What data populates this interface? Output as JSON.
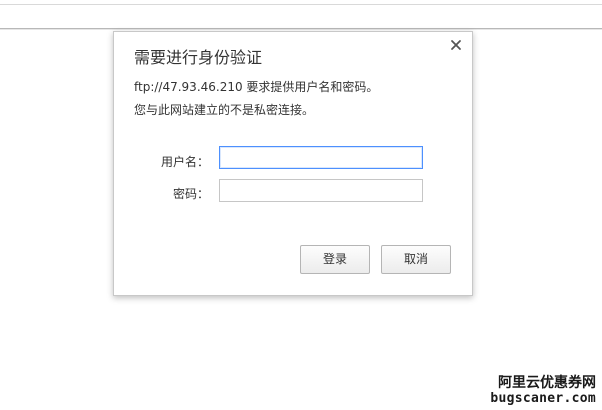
{
  "dialog": {
    "title": "需要进行身份验证",
    "message_url": "ftp://47.93.46.210 要求提供用户名和密码。",
    "message_private": "您与此网站建立的不是私密连接。",
    "username_label": "用户名：",
    "password_label": "密码：",
    "username_value": "",
    "password_value": "",
    "login_label": "登录",
    "cancel_label": "取消",
    "close_icon": "close-icon"
  },
  "watermark": {
    "line1": "阿里云优惠券网",
    "line2": "bugscaner.com"
  },
  "colors": {
    "focus_border": "#4d90fe",
    "text": "#333333",
    "button_border": "#b5b5b5"
  }
}
